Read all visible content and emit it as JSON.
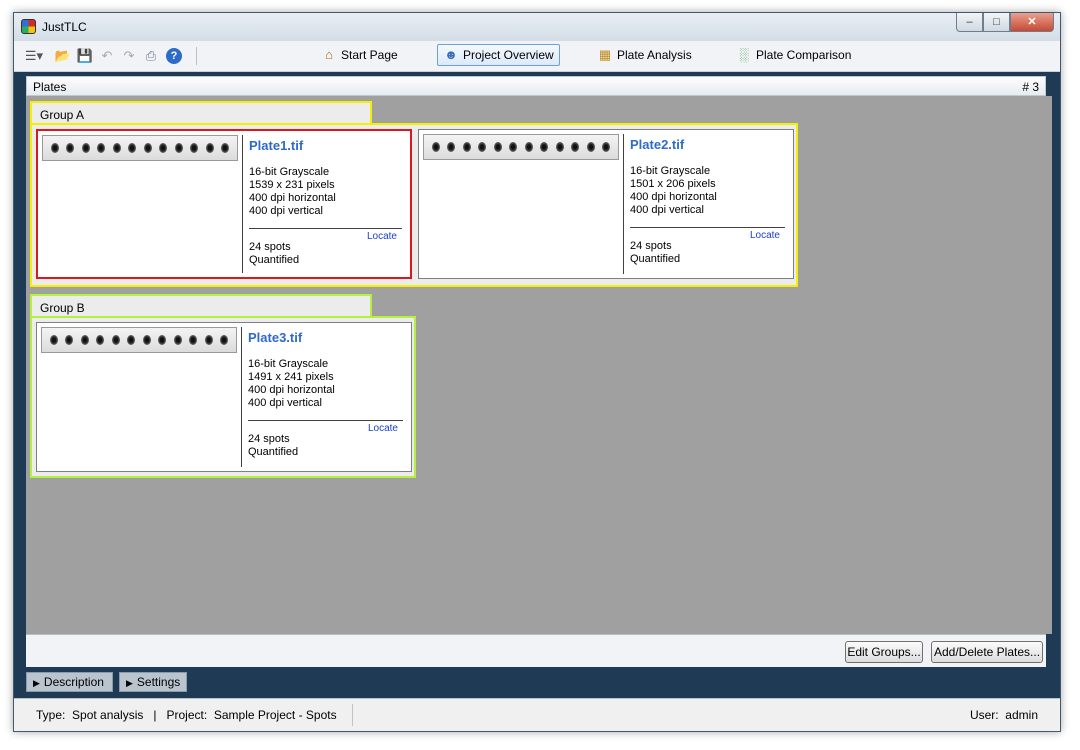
{
  "window": {
    "title": "JustTLC"
  },
  "toolbar": {
    "nav": [
      {
        "label": "Start Page",
        "icon": "home-icon"
      },
      {
        "label": "Project Overview",
        "icon": "people-icon",
        "active": true
      },
      {
        "label": "Plate Analysis",
        "icon": "plate-icon"
      },
      {
        "label": "Plate Comparison",
        "icon": "bar-chart-icon"
      }
    ]
  },
  "panel": {
    "title": "Plates",
    "count": "# 3"
  },
  "groups": [
    {
      "name": "Group A",
      "plates": [
        {
          "name": "Plate1.tif",
          "info": [
            "16-bit Grayscale",
            "1539 x 231 pixels",
            "400 dpi horizontal",
            "400 dpi vertical"
          ],
          "locate": "Locate",
          "stats": [
            "24 spots",
            "Quantified"
          ]
        },
        {
          "name": "Plate2.tif",
          "info": [
            "16-bit Grayscale",
            "1501 x 206 pixels",
            "400 dpi horizontal",
            "400 dpi vertical"
          ],
          "locate": "Locate",
          "stats": [
            "24 spots",
            "Quantified"
          ]
        }
      ]
    },
    {
      "name": "Group B",
      "plates": [
        {
          "name": "Plate3.tif",
          "info": [
            "16-bit Grayscale",
            "1491 x 241 pixels",
            "400 dpi horizontal",
            "400 dpi vertical"
          ],
          "locate": "Locate",
          "stats": [
            "24 spots",
            "Quantified"
          ]
        }
      ]
    }
  ],
  "buttons": {
    "edit_groups": "Edit Groups...",
    "add_delete": "Add/Delete Plates..."
  },
  "tabs": {
    "description": "Description",
    "settings": "Settings"
  },
  "status": {
    "left": "Type:  Spot analysis   |   Project:  Sample Project - Spots",
    "user": "User:  admin"
  },
  "colors": {
    "group_a_border": "#f5f000",
    "group_b_border": "#b5f03c",
    "selected_border": "#d81a1a",
    "plate_name": "#2e6bc8",
    "canvas": "#a0a0a0",
    "window_frame": "#1f3a55"
  }
}
